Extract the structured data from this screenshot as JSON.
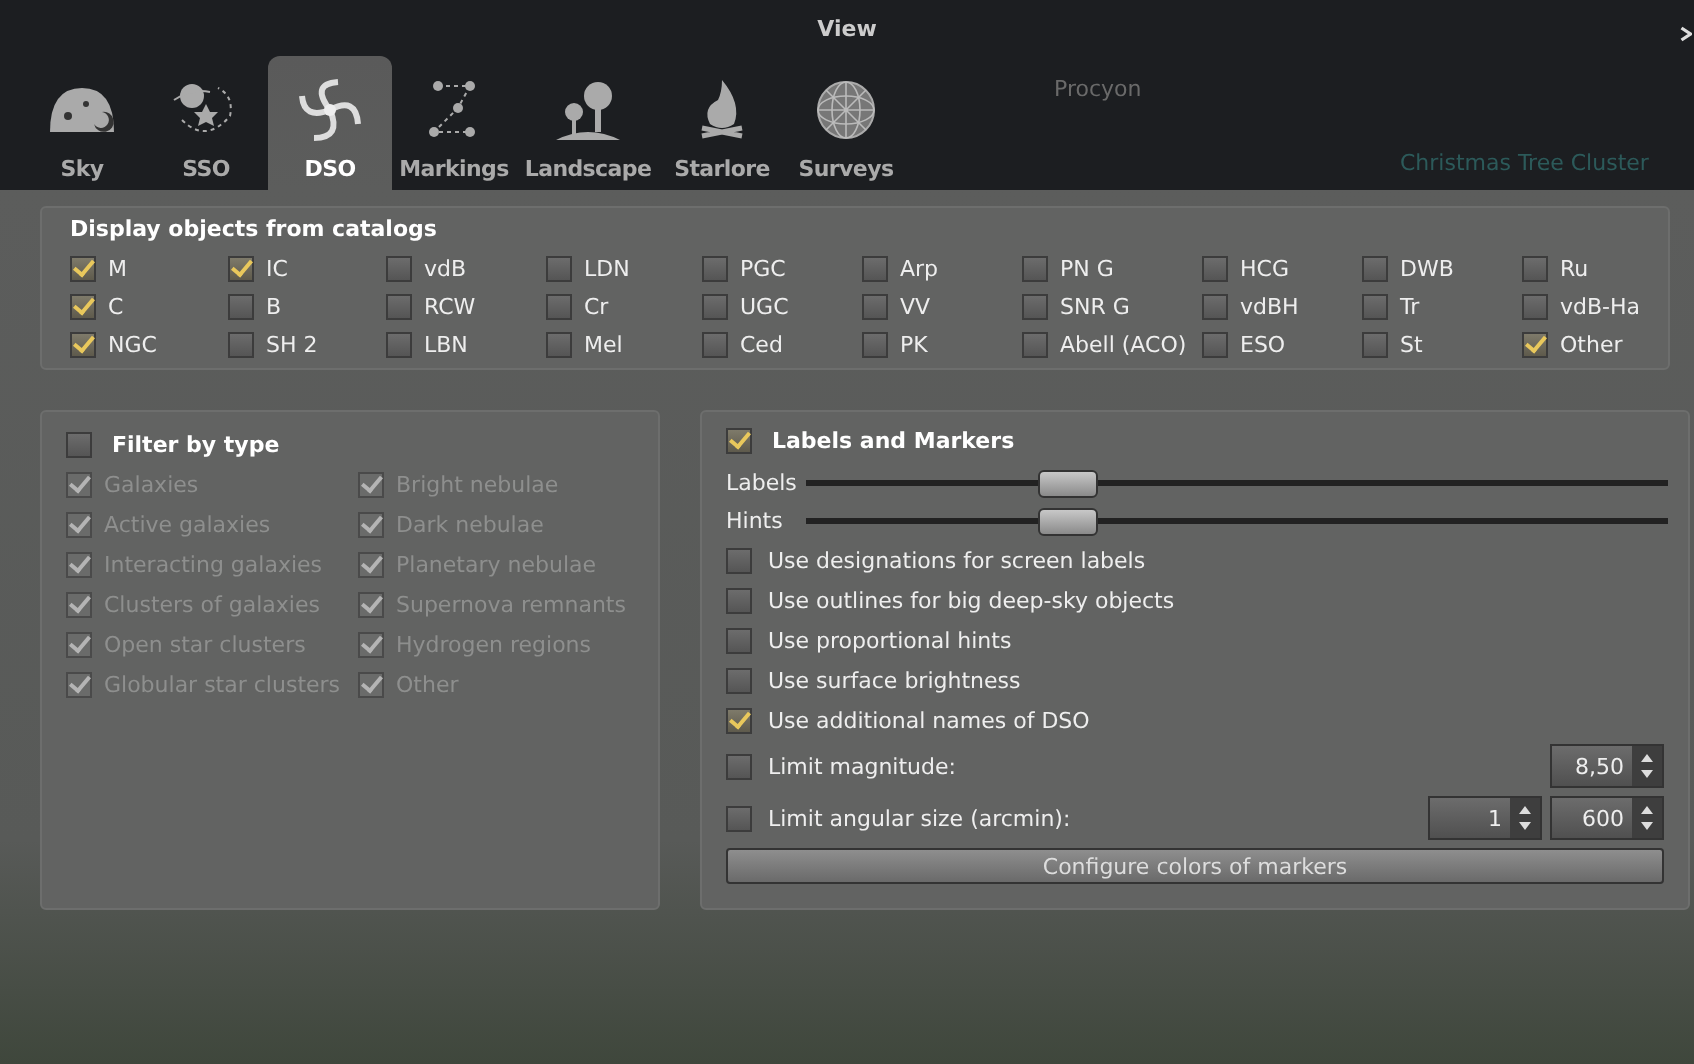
{
  "window": {
    "title": "View"
  },
  "sky_labels": [
    {
      "label": "Procyon",
      "kind": "star"
    },
    {
      "label": "Christmas Tree Cluster",
      "kind": "dso"
    }
  ],
  "tabs": [
    {
      "label": "Sky",
      "kind": "sky",
      "selected": false
    },
    {
      "label": "SSO",
      "kind": "sso",
      "selected": false
    },
    {
      "label": "DSO",
      "kind": "dso",
      "selected": true
    },
    {
      "label": "Markings",
      "kind": "markings",
      "selected": false
    },
    {
      "label": "Landscape",
      "kind": "landscape",
      "selected": false
    },
    {
      "label": "Starlore",
      "kind": "starlore",
      "selected": false
    },
    {
      "label": "Surveys",
      "kind": "surveys",
      "selected": false
    }
  ],
  "catalogs": {
    "title": "Display objects from catalogs",
    "items": [
      {
        "label": "M",
        "checked": true
      },
      {
        "label": "IC",
        "checked": true
      },
      {
        "label": "vdB",
        "checked": false
      },
      {
        "label": "LDN",
        "checked": false
      },
      {
        "label": "PGC",
        "checked": false
      },
      {
        "label": "Arp",
        "checked": false
      },
      {
        "label": "PN G",
        "checked": false
      },
      {
        "label": "HCG",
        "checked": false
      },
      {
        "label": "DWB",
        "checked": false
      },
      {
        "label": "Ru",
        "checked": false
      },
      {
        "label": "C",
        "checked": true
      },
      {
        "label": "B",
        "checked": false
      },
      {
        "label": "RCW",
        "checked": false
      },
      {
        "label": "Cr",
        "checked": false
      },
      {
        "label": "UGC",
        "checked": false
      },
      {
        "label": "VV",
        "checked": false
      },
      {
        "label": "SNR G",
        "checked": false
      },
      {
        "label": "vdBH",
        "checked": false
      },
      {
        "label": "Tr",
        "checked": false
      },
      {
        "label": "vdB-Ha",
        "checked": false
      },
      {
        "label": "NGC",
        "checked": true
      },
      {
        "label": "SH 2",
        "checked": false
      },
      {
        "label": "LBN",
        "checked": false
      },
      {
        "label": "Mel",
        "checked": false
      },
      {
        "label": "Ced",
        "checked": false
      },
      {
        "label": "PK",
        "checked": false
      },
      {
        "label": "Abell (ACO)",
        "checked": false
      },
      {
        "label": "ESO",
        "checked": false
      },
      {
        "label": "St",
        "checked": false
      },
      {
        "label": "Other",
        "checked": true
      }
    ]
  },
  "filter": {
    "title": "Filter by type",
    "checked": false,
    "items": [
      {
        "label": "Galaxies",
        "checked": true
      },
      {
        "label": "Bright nebulae",
        "checked": true
      },
      {
        "label": "Active galaxies",
        "checked": true
      },
      {
        "label": "Dark nebulae",
        "checked": true
      },
      {
        "label": "Interacting galaxies",
        "checked": true
      },
      {
        "label": "Planetary nebulae",
        "checked": true
      },
      {
        "label": "Clusters of galaxies",
        "checked": true
      },
      {
        "label": "Supernova remnants",
        "checked": true
      },
      {
        "label": "Open star clusters",
        "checked": true
      },
      {
        "label": "Hydrogen regions",
        "checked": true
      },
      {
        "label": "Globular star clusters",
        "checked": true
      },
      {
        "label": "Other",
        "checked": true
      }
    ]
  },
  "labels_markers": {
    "title": "Labels and Markers",
    "checked": true,
    "sliders": [
      {
        "label": "Labels",
        "level": 0.32
      },
      {
        "label": "Hints",
        "level": 0.32
      }
    ],
    "options": [
      {
        "label": "Use designations for screen labels",
        "checked": false
      },
      {
        "label": "Use outlines for big deep-sky objects",
        "checked": false
      },
      {
        "label": "Use proportional hints",
        "checked": false
      },
      {
        "label": "Use surface brightness",
        "checked": false
      },
      {
        "label": "Use additional names of DSO",
        "checked": true
      }
    ],
    "limits": [
      {
        "label": "Limit magnitude:",
        "checked": false,
        "values": [
          "8,50"
        ]
      },
      {
        "label": "Limit angular size (arcmin):",
        "checked": false,
        "values": [
          "1",
          "600"
        ]
      }
    ],
    "button": "Configure colors of markers"
  }
}
